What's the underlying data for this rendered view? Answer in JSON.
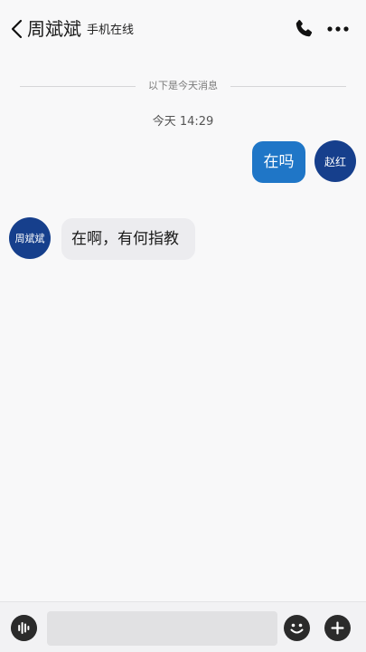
{
  "header": {
    "contact_name": "周斌斌",
    "status": "手机在线"
  },
  "notice": "以下是今天消息",
  "timestamp": "今天 14:29",
  "messages": [
    {
      "sender": "me",
      "avatar_text": "赵红",
      "text": "在吗"
    },
    {
      "sender": "other",
      "avatar_text": "周斌斌",
      "text": "在啊，有何指教"
    }
  ],
  "input": {
    "placeholder": ""
  },
  "icons": {
    "back": "chevron-left-icon",
    "call": "phone-icon",
    "more": "more-icon",
    "voice": "voice-icon",
    "emoji": "emoji-icon",
    "add": "plus-icon"
  },
  "colors": {
    "my_bubble": "#1f76c7",
    "other_bubble": "#ececef",
    "avatar": "#163f8c"
  }
}
